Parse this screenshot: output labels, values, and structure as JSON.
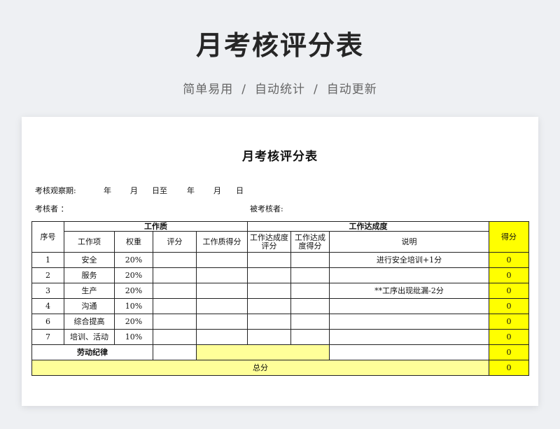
{
  "banner": {
    "title": "月考核评分表",
    "subtitle": [
      "简单易用",
      "自动统计",
      "自动更新"
    ],
    "separator": "/"
  },
  "doc": {
    "title": "月考核评分表",
    "period_label": "考核观察期:",
    "period_year1": "年",
    "period_month1": "月",
    "period_day_to": "日至",
    "period_year2": "年",
    "period_month2": "月",
    "period_day2": "日",
    "examiner_label": "考核者 ：",
    "examinee_label": "被考核者:"
  },
  "table": {
    "headers": {
      "index": "序号",
      "work_quality": "工作质",
      "work_achievement": "工作达成度",
      "score": "得分",
      "work_item": "工作项",
      "weight": "权重",
      "rating": "评分",
      "quality_score": "工作质得分",
      "achievement_rating": "工作达成度评分",
      "achievement_score": "工作达成度得分",
      "note": "说明"
    },
    "rows": [
      {
        "index": "1",
        "item": "安全",
        "weight": "20%",
        "note": "进行安全培训+1分",
        "score": "0"
      },
      {
        "index": "2",
        "item": "服务",
        "weight": "20%",
        "note": "",
        "score": "0"
      },
      {
        "index": "3",
        "item": "生产",
        "weight": "20%",
        "note": "**工序出现纰漏-2分",
        "score": "0"
      },
      {
        "index": "4",
        "item": "沟通",
        "weight": "10%",
        "note": "",
        "score": "0"
      },
      {
        "index": "6",
        "item": "综合提高",
        "weight": "20%",
        "note": "",
        "score": "0"
      },
      {
        "index": "7",
        "item": "培训、活动",
        "weight": "10%",
        "note": "",
        "score": "0"
      }
    ],
    "discipline_label": "劳动纪律",
    "discipline_score": "0",
    "total_label": "总分",
    "total_score": "0"
  },
  "colors": {
    "highlight_yellow": "#ffff00",
    "light_yellow": "#ffff99"
  }
}
